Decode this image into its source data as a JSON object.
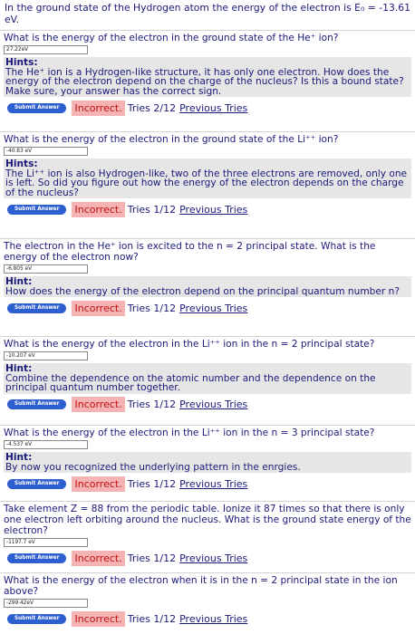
{
  "intro": "In the ground state of the Hydrogen atom the energy of the electron is E₀ = -13.61 eV.",
  "submit_label": "Submit Answer",
  "prev_label": "Previous Tries",
  "questions": [
    {
      "text": "What is the energy of the electron in the ground state of the He⁺ ion?",
      "answer": "27.22eV",
      "hint_title": "Hints:",
      "hint": "The He⁺ ion is a Hydrogen-like structure, it has only one electron. How does the energy of the electron depend on the charge of the nucleus? Is this a bound state? Make sure, your answer has the correct sign.",
      "status": "Incorrect.",
      "tries": "Tries 2/12"
    },
    {
      "text": "What is the energy of the electron in the ground state of the Li⁺⁺ ion?",
      "answer": "-40.83 eV",
      "hint_title": "Hints:",
      "hint": "The Li⁺⁺ ion is also Hydrogen-like, two of the three electrons are removed, only one is left. So did you figure out how the energy of the electron depends on the charge of the nucleus?",
      "status": "Incorrect.",
      "tries": "Tries 1/12"
    },
    {
      "text": "The electron in the He⁺ ion is excited to the n = 2 principal state. What is the energy of the electron now?",
      "answer": "-6.805 eV",
      "hint_title": "Hint:",
      "hint": "How does the energy of the electron depend on the principal quantum number n?",
      "status": "Incorrect.",
      "tries": "Tries 1/12"
    },
    {
      "text": "What is the energy of the electron in the Li⁺⁺ ion in the n = 2 principal state?",
      "answer": "-10.207 eV",
      "hint_title": "Hint:",
      "hint": "Combine the dependence on the atomic number and the dependence on the principal quantum number together.",
      "status": "Incorrect.",
      "tries": "Tries 1/12"
    },
    {
      "text": "What is the energy of the electron in the Li⁺⁺ ion in the n = 3 principal state?",
      "answer": "-4.537 eV",
      "hint_title": "Hint:",
      "hint": "By now you recognized the underlying pattern in the enrgies.",
      "status": "Incorrect.",
      "tries": "Tries 1/12"
    },
    {
      "text": "Take element Z = 88 from the periodic table. Ionize it 87 times so that there is only one electron left orbiting around the nucleus. What is the ground state energy of the electron?",
      "answer": "-1197.7 eV",
      "hint_title": "",
      "hint": "",
      "status": "Incorrect.",
      "tries": "Tries 1/12"
    },
    {
      "text": "What is the energy of the electron when it is in the n = 2 principal state in the ion above?",
      "answer": "-299.42eV",
      "hint_title": "",
      "hint": "",
      "status": "Incorrect.",
      "tries": "Tries 1/12"
    }
  ]
}
